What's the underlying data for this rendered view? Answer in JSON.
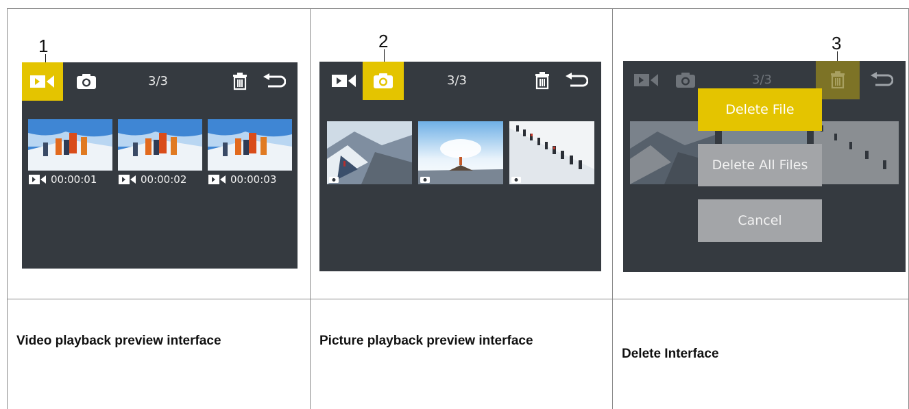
{
  "panels": [
    {
      "callout": "1",
      "counter": "3/3",
      "timecodes": [
        "00:00:01",
        "00:00:02",
        "00:00:03"
      ],
      "caption": "Video playback preview interface"
    },
    {
      "callout": "2",
      "counter": "3/3",
      "caption": "Picture playback preview interface"
    },
    {
      "callout": "3",
      "counter": "3/3",
      "menu": [
        "Delete File",
        "Delete All Files",
        "Cancel"
      ],
      "caption": "Delete Interface"
    }
  ],
  "icons": {
    "video": "video-camera-icon",
    "photo": "photo-camera-icon",
    "delete": "trash-icon",
    "back": "back-arrow-icon"
  },
  "colors": {
    "screen_bg": "#353a40",
    "accent": "#e4c400",
    "button_gray": "#a3a5a8",
    "text_light": "#e8e8e8"
  }
}
